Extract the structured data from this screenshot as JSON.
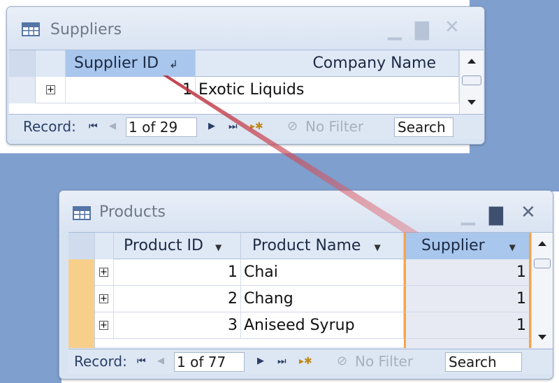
{
  "suppliers_window": {
    "title": "Suppliers",
    "columns": [
      "Supplier ID",
      "Company Name"
    ],
    "rows": [
      {
        "id": "1",
        "company": "Exotic Liquids"
      }
    ],
    "nav": {
      "label": "Record:",
      "position": "1 of 29",
      "filter": "No Filter",
      "search": "Search"
    }
  },
  "products_window": {
    "title": "Products",
    "columns": [
      "Product ID",
      "Product Name",
      "Supplier"
    ],
    "rows": [
      {
        "id": "1",
        "name": "Chai",
        "supplier": "1"
      },
      {
        "id": "2",
        "name": "Chang",
        "supplier": "1"
      },
      {
        "id": "3",
        "name": "Aniseed Syrup",
        "supplier": "1"
      }
    ],
    "nav": {
      "label": "Record:",
      "position": "1 of 77",
      "filter": "No Filter",
      "search": "Search"
    }
  },
  "colors": {
    "relationship_highlight": "#f5a54a",
    "relationship_wedge": "#c8202b",
    "header_selected": "#a9c6ec"
  },
  "icons": [
    "table-icon",
    "minimize-icon",
    "maximize-icon",
    "close-icon",
    "sort-icon",
    "first-record-icon",
    "prev-record-icon",
    "next-record-icon",
    "last-record-icon",
    "new-record-icon",
    "filter-icon",
    "expand-icon"
  ]
}
